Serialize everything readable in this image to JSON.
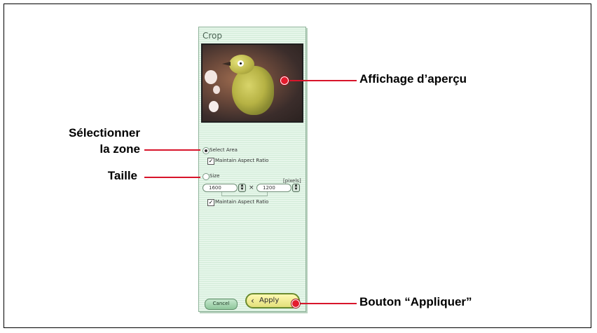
{
  "panel": {
    "title": "Crop",
    "select_area_label": "Select Area",
    "maintain_ratio_label_1": "Maintain Aspect Ratio",
    "size_label": "Size",
    "units_label": "[pixels]",
    "width_value": "1600",
    "height_value": "1200",
    "times_symbol": "×",
    "maintain_ratio_label_2": "Maintain Aspect Ratio",
    "cancel_label": "Cancel",
    "apply_label": "Apply"
  },
  "annotations": {
    "preview": "Affichage d’aperçu",
    "select_area_line1": "Sélectionner",
    "select_area_line2": "la zone",
    "size": "Taille",
    "apply": "Bouton “Appliquer”"
  },
  "colors": {
    "callout": "#d8152b",
    "panel_bg": "#e6f6ea",
    "apply_button": "#fff9b2"
  }
}
